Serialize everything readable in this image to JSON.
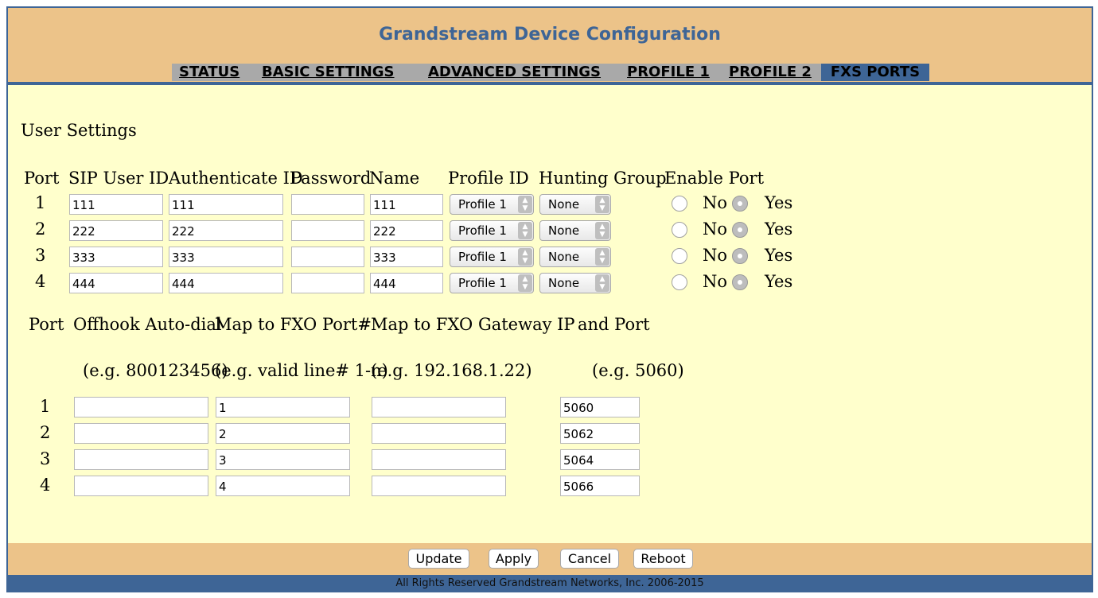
{
  "header": {
    "title": "Grandstream Device Configuration",
    "tabs": [
      "STATUS",
      "BASIC SETTINGS",
      "ADVANCED SETTINGS",
      "PROFILE 1",
      "PROFILE 2",
      "FXS PORTS"
    ],
    "active_tab": "FXS PORTS"
  },
  "user_settings": {
    "heading": "User Settings",
    "columns": [
      "Port",
      "SIP User ID",
      "Authenticate ID",
      "Password",
      "Name",
      "Profile ID",
      "Hunting Group",
      "Enable Port"
    ],
    "no_label": "No",
    "yes_label": "Yes",
    "rows": [
      {
        "port": "1",
        "sip_user_id": "111",
        "auth_id": "111",
        "password": "",
        "name": "111",
        "profile": "Profile 1",
        "hunting": "None",
        "enabled": "Yes"
      },
      {
        "port": "2",
        "sip_user_id": "222",
        "auth_id": "222",
        "password": "",
        "name": "222",
        "profile": "Profile 1",
        "hunting": "None",
        "enabled": "Yes"
      },
      {
        "port": "3",
        "sip_user_id": "333",
        "auth_id": "333",
        "password": "",
        "name": "333",
        "profile": "Profile 1",
        "hunting": "None",
        "enabled": "Yes"
      },
      {
        "port": "4",
        "sip_user_id": "444",
        "auth_id": "444",
        "password": "",
        "name": "444",
        "profile": "Profile 1",
        "hunting": "None",
        "enabled": "Yes"
      }
    ]
  },
  "fxo_mapping": {
    "columns": [
      "Port",
      "Offhook Auto-dial",
      "Map to FXO Port#",
      "Map to FXO Gateway IP",
      "and Port"
    ],
    "examples": [
      "(e.g. 800123456)",
      "(e.g. valid line# 1-n)",
      "(e.g. 192.168.1.22)",
      "(e.g. 5060)"
    ],
    "rows": [
      {
        "port": "1",
        "autodial": "",
        "fxo_port": "1",
        "gateway_ip": "",
        "gw_port": "5060"
      },
      {
        "port": "2",
        "autodial": "",
        "fxo_port": "2",
        "gateway_ip": "",
        "gw_port": "5062"
      },
      {
        "port": "3",
        "autodial": "",
        "fxo_port": "3",
        "gateway_ip": "",
        "gw_port": "5064"
      },
      {
        "port": "4",
        "autodial": "",
        "fxo_port": "4",
        "gateway_ip": "",
        "gw_port": "5066"
      }
    ]
  },
  "footer": {
    "buttons": [
      "Update",
      "Apply",
      "Cancel",
      "Reboot"
    ],
    "copyright": "All Rights Reserved Grandstream Networks, Inc. 2006-2015"
  },
  "colors": {
    "header_bg": "#ecc389",
    "accent_blue": "#3e6596",
    "content_bg": "#ffffcc",
    "tab_bar_gray": "#a9a9a9"
  }
}
